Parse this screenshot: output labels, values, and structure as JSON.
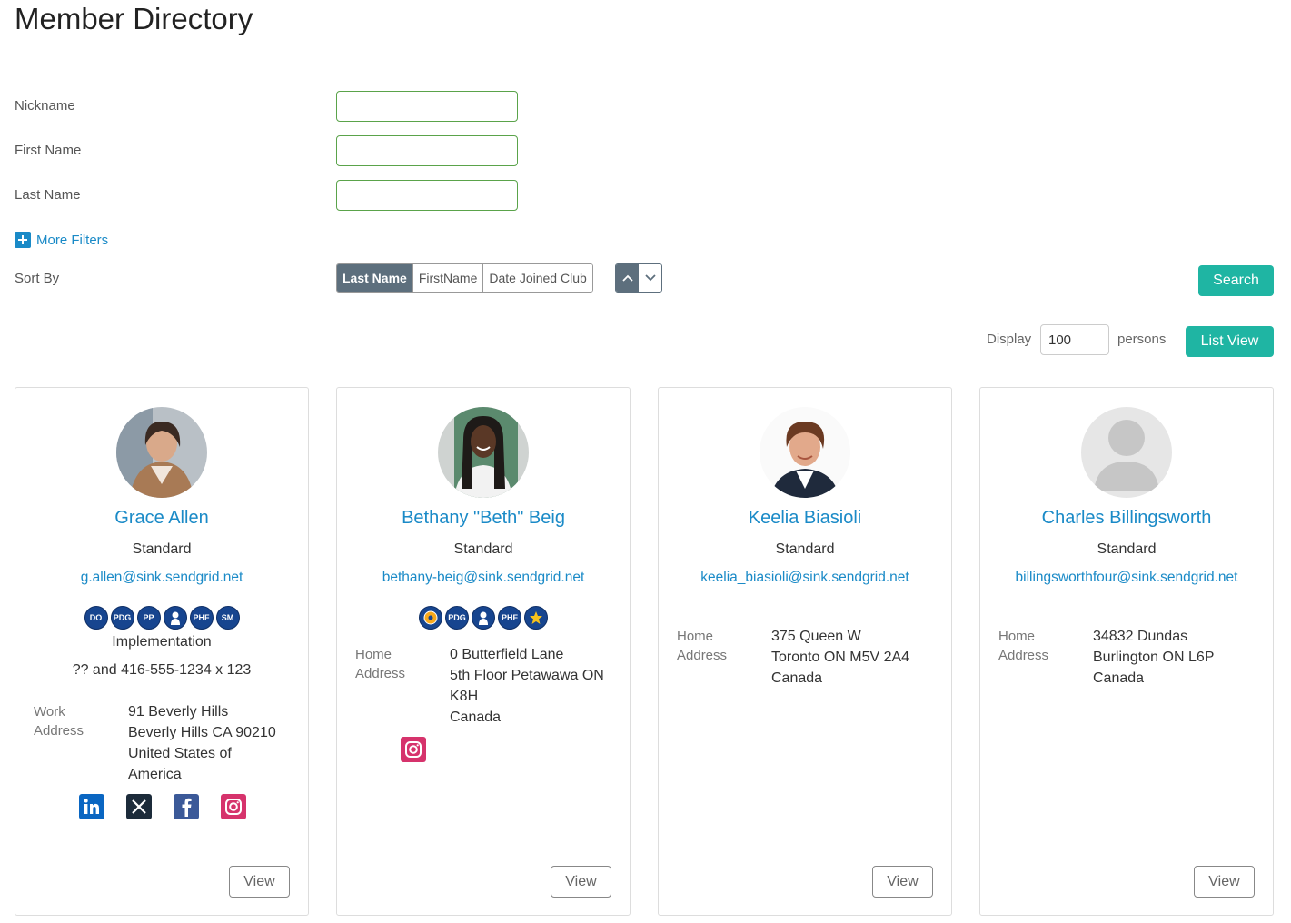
{
  "page": {
    "title": "Member Directory"
  },
  "filters": {
    "nickname_label": "Nickname",
    "nickname_value": "",
    "first_name_label": "First Name",
    "first_name_value": "",
    "last_name_label": "Last Name",
    "last_name_value": "",
    "more_filters_label": "More Filters"
  },
  "sort": {
    "label": "Sort By",
    "options": [
      "Last Name",
      "FirstName",
      "Date Joined Club"
    ],
    "selected": "Last Name",
    "direction": "ascending"
  },
  "actions": {
    "search_label": "Search",
    "display_label": "Display",
    "display_value": "100",
    "persons_label": "persons",
    "list_view_label": "List View"
  },
  "colors": {
    "accent": "#1fb5a3",
    "link": "#1a8ac7",
    "badge": "#17458f",
    "sort_active": "#5d6f7d"
  },
  "members": [
    {
      "name": "Grace Allen",
      "type": "Standard",
      "email": "g.allen@sink.sendgrid.net",
      "badges": [
        "DO",
        "PDG",
        "PP",
        "person-icon",
        "PHF",
        "SM"
      ],
      "classification": "Implementation",
      "phone": "?? and 416-555-1234 x 123",
      "address_label_1": "Work",
      "address_label_2": "Address",
      "address_lines": [
        "91 Beverly Hills",
        "Beverly Hills CA 90210",
        "United States of",
        "America"
      ],
      "socials": [
        "linkedin-icon",
        "x-icon",
        "facebook-icon",
        "instagram-icon"
      ],
      "view_label": "View"
    },
    {
      "name": "Bethany \"Beth\" Beig",
      "type": "Standard",
      "email": "bethany-beig@sink.sendgrid.net",
      "badges": [
        "rotary-wheel-icon",
        "PDG",
        "person-icon",
        "PHF",
        "star-icon"
      ],
      "address_label_1": "Home",
      "address_label_2": "Address",
      "address_lines": [
        "0 Butterfield Lane",
        "5th Floor Petawawa ON",
        "K8H",
        "Canada"
      ],
      "socials": [
        "instagram-icon"
      ],
      "view_label": "View"
    },
    {
      "name": "Keelia Biasioli",
      "type": "Standard",
      "email": "keelia_biasioli@sink.sendgrid.net",
      "address_label_1": "Home",
      "address_label_2": "Address",
      "address_lines": [
        "375 Queen W",
        "Toronto ON M5V 2A4",
        "Canada"
      ],
      "view_label": "View"
    },
    {
      "name": "Charles Billingsworth",
      "type": "Standard",
      "email": "billingsworthfour@sink.sendgrid.net",
      "address_label_1": "Home",
      "address_label_2": "Address",
      "address_lines": [
        "34832 Dundas",
        "Burlington ON L6P",
        "Canada"
      ],
      "view_label": "View"
    }
  ]
}
